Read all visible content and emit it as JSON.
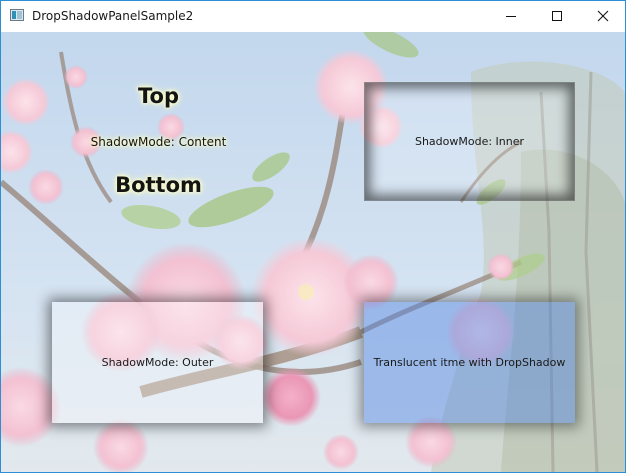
{
  "window": {
    "title": "DropShadowPanelSample2",
    "icon": "app-window-icon",
    "controls": {
      "minimize": "minimize-icon",
      "maximize": "maximize-icon",
      "close": "close-icon"
    }
  },
  "content_mode_sample": {
    "top_label": "Top",
    "mode_label": "ShadowMode: Content",
    "bottom_label": "Bottom",
    "glow_color": "#ffffcc"
  },
  "panels": {
    "inner": {
      "label": "ShadowMode: Inner"
    },
    "outer": {
      "label": "ShadowMode: Outer"
    },
    "translucent": {
      "label": "Translucent itme with DropShadow",
      "tint_color": "#467de1"
    }
  },
  "background": {
    "description_icon": "cherry-blossom-photo",
    "sky_color": "#b9d3ec",
    "blossom_color": "#f4b8cb"
  }
}
